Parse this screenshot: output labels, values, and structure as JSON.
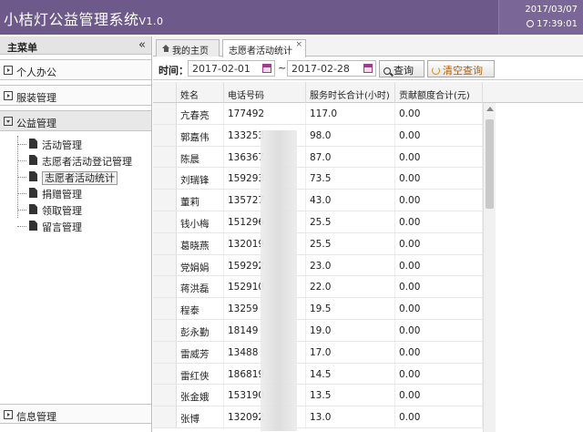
{
  "header": {
    "title": "小桔灯公益管理系统",
    "version": "V1.0",
    "date": "2017/03/07",
    "time": "17:39:01"
  },
  "sidebar": {
    "title": "主菜单",
    "collapse_glyph": "«",
    "sections": [
      {
        "label": "个人办公"
      },
      {
        "label": "服装管理"
      },
      {
        "label": "公益管理"
      }
    ],
    "tree_items": [
      {
        "label": "活动管理"
      },
      {
        "label": "志愿者活动登记管理"
      },
      {
        "label": "志愿者活动统计"
      },
      {
        "label": "捐赠管理"
      },
      {
        "label": "领取管理"
      },
      {
        "label": "留言管理"
      }
    ],
    "bottom_section": {
      "label": "信息管理"
    }
  },
  "tabs": [
    {
      "label": "我的主页"
    },
    {
      "label": "志愿者活动统计",
      "close": "×"
    }
  ],
  "toolbar": {
    "time_label": "时间：",
    "start_date": "2017-02-01",
    "separator": "~",
    "end_date": "2017-02-28",
    "query_label": "查询",
    "clear_label": "清空查询"
  },
  "table": {
    "columns": [
      "姓名",
      "电话号码",
      "服务时长合计(小时)",
      "贡献额度合计(元)"
    ],
    "rows": [
      {
        "name": "亢春亮",
        "phone": "177492",
        "hours": "117.0",
        "amount": "0.00"
      },
      {
        "name": "郭嘉伟",
        "phone": "133253",
        "hours": "98.0",
        "amount": "0.00"
      },
      {
        "name": "陈晨",
        "phone": "136367",
        "hours": "87.0",
        "amount": "0.00"
      },
      {
        "name": "刘瑞锋",
        "phone": "159293",
        "hours": "73.5",
        "amount": "0.00"
      },
      {
        "name": "董莉",
        "phone": "135727",
        "hours": "43.0",
        "amount": "0.00"
      },
      {
        "name": "钱小梅",
        "phone": "151296",
        "hours": "25.5",
        "amount": "0.00"
      },
      {
        "name": "葛晓燕",
        "phone": "132019",
        "hours": "25.5",
        "amount": "0.00"
      },
      {
        "name": "党娟娟",
        "phone": "159292",
        "hours": "23.0",
        "amount": "0.00"
      },
      {
        "name": "蒋洪磊",
        "phone": "152910",
        "hours": "22.0",
        "amount": "0.00"
      },
      {
        "name": "程泰",
        "phone": "13259",
        "hours": "19.5",
        "amount": "0.00"
      },
      {
        "name": "彭永勤",
        "phone": "18149",
        "hours": "19.0",
        "amount": "0.00"
      },
      {
        "name": "雷威芳",
        "phone": "13488",
        "hours": "17.0",
        "amount": "0.00"
      },
      {
        "name": "雷红侠",
        "phone": "186819",
        "hours": "14.5",
        "amount": "0.00"
      },
      {
        "name": "张金娥",
        "phone": "153190",
        "hours": "13.5",
        "amount": "0.00"
      },
      {
        "name": "张博",
        "phone": "132092",
        "hours": "13.0",
        "amount": "0.00"
      }
    ]
  }
}
